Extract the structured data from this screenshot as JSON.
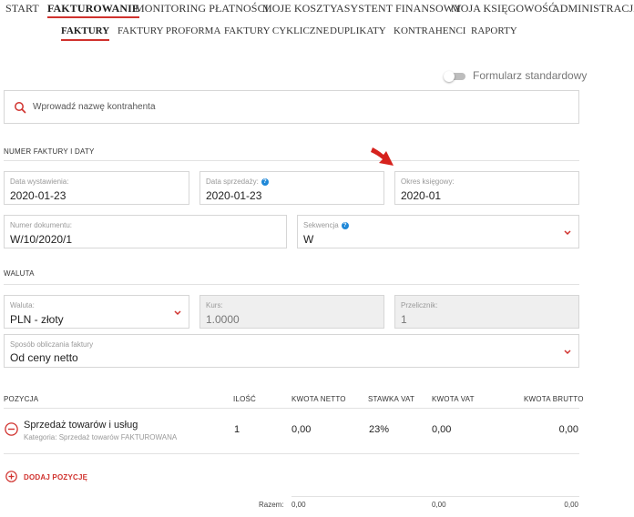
{
  "top_nav": {
    "items": [
      {
        "label": "START"
      },
      {
        "label": "FAKTUROWANIE"
      },
      {
        "label": "MONITORING PŁATNOŚCI"
      },
      {
        "label": "MOJE KOSZTY"
      },
      {
        "label": "ASYSTENT FINANSOWY"
      },
      {
        "label": "MOJA KSIĘGOWOŚĆ"
      },
      {
        "label": "ADMINISTRACJA"
      }
    ],
    "active_index": 1
  },
  "sub_nav": {
    "items": [
      {
        "label": "FAKTURY"
      },
      {
        "label": "FAKTURY PROFORMA"
      },
      {
        "label": "FAKTURY CYKLICZNE"
      },
      {
        "label": "DUPLIKATY"
      },
      {
        "label": "KONTRAHENCI"
      },
      {
        "label": "RAPORTY"
      }
    ],
    "active_index": 0
  },
  "form_toggle": {
    "label": "Formularz standardowy",
    "on": false
  },
  "search": {
    "placeholder": "Wprowadź nazwę kontrahenta",
    "icon": "search-icon"
  },
  "section_invoice": {
    "title": "NUMER FAKTURY I DATY"
  },
  "fields": {
    "issue_date": {
      "label": "Data wystawienia:",
      "value": "2020-01-23"
    },
    "sale_date": {
      "label": "Data sprzedaży:",
      "value": "2020-01-23",
      "help": "?"
    },
    "accounting_period": {
      "label": "Okres księgowy:",
      "value": "2020-01"
    },
    "document_number": {
      "label": "Numer dokumentu:",
      "value": "W/10/2020/1"
    },
    "sequence": {
      "label": "Sekwencja",
      "value": "W",
      "help": "?"
    }
  },
  "section_currency": {
    "title": "WALUTA"
  },
  "currency": {
    "currency": {
      "label": "Waluta:",
      "value": "PLN - złoty"
    },
    "rate": {
      "label": "Kurs:",
      "value": "1.0000"
    },
    "multiplier": {
      "label": "Przelicznik:",
      "value": "1"
    },
    "calc_method": {
      "label": "Sposób obliczania faktury",
      "value": "Od ceny netto"
    }
  },
  "table": {
    "headers": {
      "position": "POZYCJA",
      "quantity": "ILOŚĆ",
      "net": "KWOTA NETTO",
      "vat_rate": "STAWKA VAT",
      "vat": "KWOTA VAT",
      "gross": "KWOTA BRUTTO"
    },
    "rows": [
      {
        "name": "Sprzedaż towarów i usług",
        "category": "Kategoria: Sprzedaż towarów FAKTUROWANA",
        "quantity": "1",
        "net": "0,00",
        "vat_rate": "23%",
        "vat": "0,00",
        "gross": "0,00"
      }
    ],
    "add_label": "DODAJ POZYCJĘ",
    "totals": {
      "label": "Razem:",
      "net": "0,00",
      "vat": "0,00",
      "gross": "0,00"
    }
  },
  "colors": {
    "accent": "#d0312d",
    "help": "#1f88d8",
    "border": "#d6d6d6"
  }
}
